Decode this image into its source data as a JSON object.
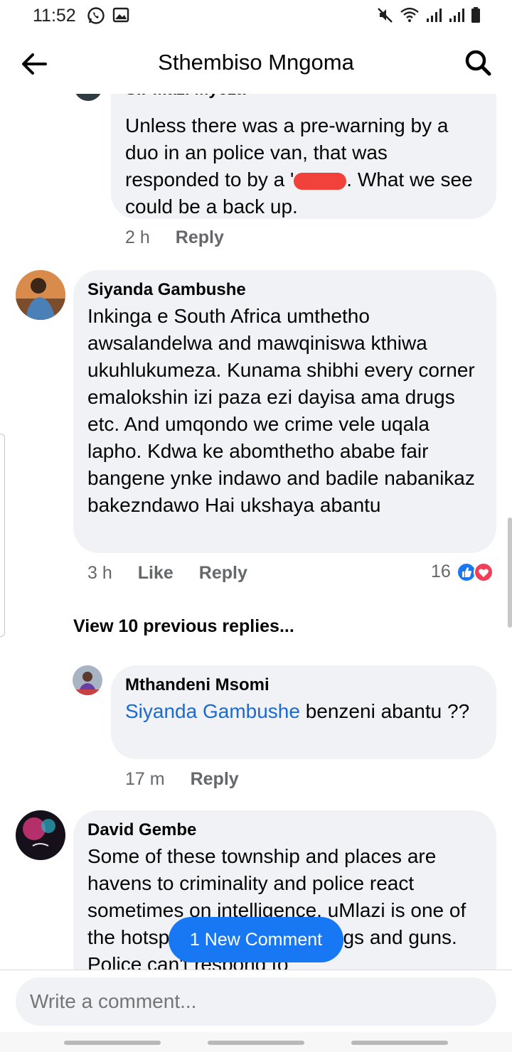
{
  "status_bar": {
    "time": "11:52",
    "left_icons": [
      "whatsapp-icon",
      "gallery-icon"
    ],
    "right_icons": [
      "mute-icon",
      "wifi-icon",
      "signal-icon",
      "signal-icon",
      "battery-icon"
    ]
  },
  "header": {
    "title": "Sthembiso Mngoma",
    "back_icon": "arrow-left-icon",
    "search_icon": "search-icon"
  },
  "comments": [
    {
      "author": "Sir Mazi Myeza",
      "text": "Unless there was a pre-warning by a duo in an police van, that was responded to by a '",
      "text_tail": ". What we see could be a back up.",
      "time": "2 h",
      "reply_label": "Reply"
    },
    {
      "author": "Siyanda Gambushe",
      "text": "Inkinga e South Africa umthetho awsalandelwa and mawqiniswa kthiwa ukuhlukumeza. Kunama shibhi every corner emalokshin izi paza ezi dayisa ama drugs etc. And umqondo we crime vele uqala lapho. Kdwa ke abomthetho ababe fair bangene ynke indawo and badile nabanikaz bakezndawo Hai ukshaya abantu",
      "time": "3 h",
      "like_label": "Like",
      "reply_label": "Reply",
      "reaction_count": "16",
      "reactions": [
        "like-icon",
        "love-icon"
      ]
    },
    {
      "author": "Mthandeni Msomi",
      "mention": "Siyanda Gambushe",
      "text": " benzeni abantu ??",
      "time": "17 m",
      "reply_label": "Reply"
    },
    {
      "author": "David Gembe",
      "text": "Some of these township and places are havens to criminality and police react sometimes on intelligence. uMlazi is one of the hotspots for criminals drugs and guns. Police can't respond to"
    }
  ],
  "view_previous": "View 10 previous replies...",
  "new_comment_button": "1 New Comment",
  "composer": {
    "placeholder": "Write a comment..."
  },
  "colors": {
    "bubble": "#f0f2f5",
    "accent": "#1877f2",
    "mention": "#1b6ad2",
    "secondary_text": "#65676b",
    "love": "#f33e58"
  }
}
